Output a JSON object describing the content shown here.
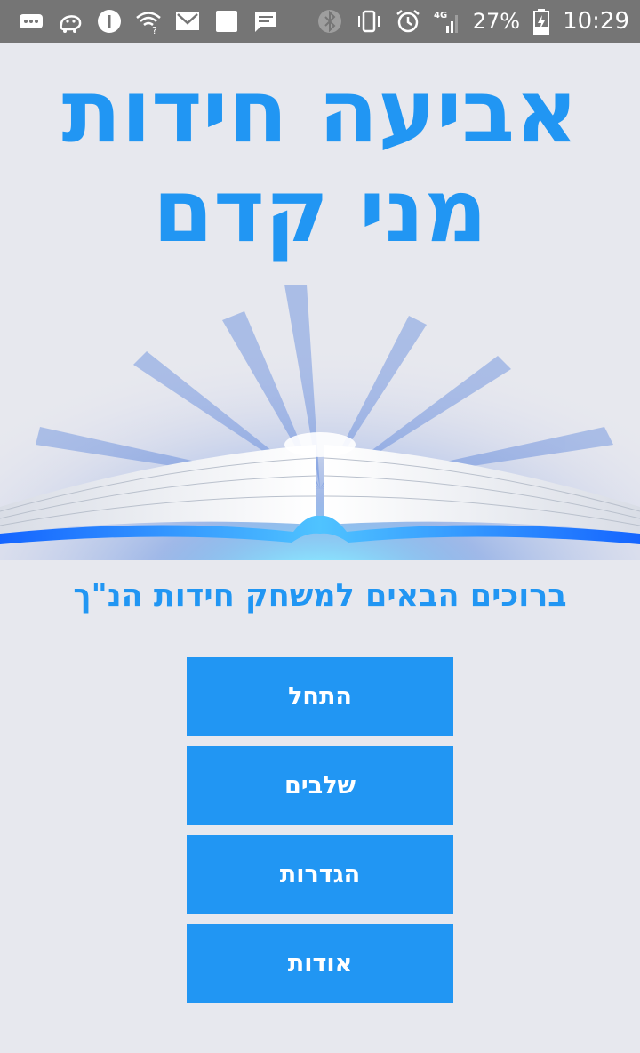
{
  "status_bar": {
    "battery_percent": "27%",
    "time": "10:29",
    "network": "4G",
    "icons_left": [
      "more-dots-icon",
      "waze-icon",
      "info-icon",
      "wifi-question-icon",
      "gmail-icon",
      "square-icon",
      "message-icon"
    ],
    "icons_right": [
      "bluetooth-icon",
      "vibrate-icon",
      "alarm-icon",
      "signal-4g-icon",
      "battery-charging-icon"
    ]
  },
  "title": {
    "line1": "אביעה חידות",
    "line2": "מני קדם"
  },
  "welcome_text": "ברוכים הבאים למשחק חידות הנ\"ך",
  "menu": {
    "start": "התחל",
    "levels": "שלבים",
    "settings": "הגדרות",
    "about": "אודות"
  },
  "colors": {
    "accent": "#2196f3",
    "background": "#e7e8ee",
    "status_bar": "#757575"
  }
}
